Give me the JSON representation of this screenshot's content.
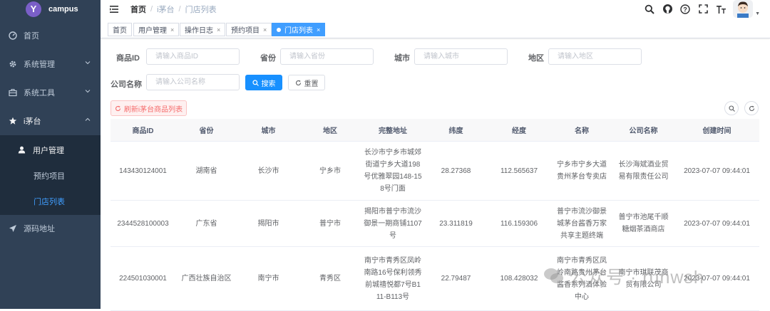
{
  "app": {
    "name": "campus",
    "logo_letter": "Y"
  },
  "sidebar": {
    "items": [
      {
        "label": "首页",
        "icon": "dashboard-icon"
      },
      {
        "label": "系统管理",
        "icon": "gear-icon"
      },
      {
        "label": "系统工具",
        "icon": "toolbox-icon"
      },
      {
        "label": "i茅台",
        "icon": "star-icon"
      },
      {
        "label": "源码地址",
        "icon": "send-icon"
      }
    ],
    "submenu": [
      {
        "label": "用户管理",
        "icon": "user-icon"
      },
      {
        "label": "预约项目"
      },
      {
        "label": "门店列表"
      }
    ]
  },
  "breadcrumb": {
    "home": "首页",
    "sep": "/",
    "parent": "i茅台",
    "current": "门店列表"
  },
  "tags": [
    {
      "label": "首页"
    },
    {
      "label": "用户管理",
      "close": "×"
    },
    {
      "label": "操作日志",
      "close": "×"
    },
    {
      "label": "预约项目",
      "close": "×"
    },
    {
      "label": "门店列表",
      "close": "×"
    }
  ],
  "form": {
    "product_id": {
      "label": "商品ID",
      "placeholder": "请输入商品ID"
    },
    "province": {
      "label": "省份",
      "placeholder": "请输入省份"
    },
    "city": {
      "label": "城市",
      "placeholder": "请输入城市"
    },
    "district": {
      "label": "地区",
      "placeholder": "请输入地区"
    },
    "company": {
      "label": "公司名称",
      "placeholder": "请输入公司名称"
    },
    "search_label": "搜索",
    "reset_label": "重置"
  },
  "toolbar": {
    "refresh_label": "刷新i茅台商品列表"
  },
  "table": {
    "headers": [
      "商品ID",
      "省份",
      "城市",
      "地区",
      "完整地址",
      "纬度",
      "经度",
      "名称",
      "公司名称",
      "创建时间"
    ],
    "rows": [
      [
        "143430124001",
        "湖南省",
        "长沙市",
        "宁乡市",
        "长沙市宁乡市城郊街道宁乡大道198号优雅翠园148-158号门面",
        "28.27368",
        "112.565637",
        "宁乡市宁乡大道贵州茅台专卖店",
        "长沙海斌酒业贸易有限责任公司",
        "2023-07-07 09:44:01"
      ],
      [
        "2344528100003",
        "广东省",
        "揭阳市",
        "普宁市",
        "揭阳市普宁市流沙御景一期商铺1107号",
        "23.311819",
        "116.159306",
        "普宁市流沙御景城茅台酱香万家共享主题终端",
        "普宁市池尾千顺糖烟茶酒商店",
        "2023-07-07 09:44:01"
      ],
      [
        "224501030001",
        "广西壮族自治区",
        "南宁市",
        "青秀区",
        "南宁市青秀区凤岭南路16号保利领秀前城禧悦都7号B111-B113号",
        "22.79487",
        "108.428032",
        "南宁市青秀区凤岭南路贵州茅台酱香系列酒体验中心",
        "南宁市琪联茂商贸有限公司",
        "2023-07-07 09:44:01"
      ]
    ]
  },
  "watermark": {
    "text": "公众号 · runwsh"
  }
}
